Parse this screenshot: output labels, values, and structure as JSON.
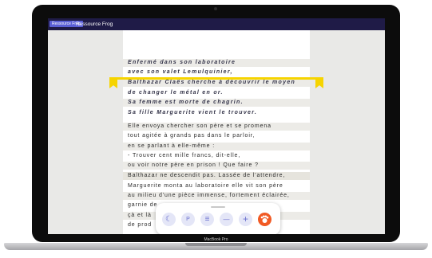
{
  "app": {
    "chip_label": "Ressource Frog",
    "title": "Ressource Frog"
  },
  "device": {
    "brand": "MacBook Pro"
  },
  "document": {
    "lines": [
      {
        "text": "Enfermé dans son laboratoire",
        "style": "italic"
      },
      {
        "text": "avec son valet Lemulquinier,",
        "style": "italic"
      },
      {
        "text": "Balthazar Claës cherche à découvrir le moyen",
        "style": "italic"
      },
      {
        "text": "de changer le métal en or.",
        "style": "italic"
      },
      {
        "text": "Sa femme est morte de chagrin.",
        "style": "italic"
      },
      {
        "text": "Sa fille Marguerite vient le trouver.",
        "style": "italic"
      },
      {
        "text": "Elle envoya chercher son père et se promena",
        "style": "normal"
      },
      {
        "text": "tout agitée à grands pas dans le parloir,",
        "style": "normal"
      },
      {
        "text": "en se parlant à elle-même :",
        "style": "normal"
      },
      {
        "text": "- Trouver cent mille francs, dit-elle,",
        "style": "normal"
      },
      {
        "text": "ou voir notre père en prison ! Que faire ?",
        "style": "normal"
      },
      {
        "text": "Balthazar ne descendit pas. Lassée de l'attendre,",
        "style": "normal"
      },
      {
        "text": "Marguerite monta au laboratoire elle vit son père",
        "style": "normal"
      },
      {
        "text": "au milieu d'une pièce immense, fortement éclairée,",
        "style": "normal"
      },
      {
        "text": "garnie de",
        "style": "normal"
      },
      {
        "text": "çà et là",
        "style": "normal"
      },
      {
        "text": "de prod",
        "style": "normal"
      }
    ]
  },
  "toolbar": {
    "buttons": [
      {
        "name": "night-mode-button",
        "icon": "moon-icon",
        "glyph": "☾"
      },
      {
        "name": "parking-button",
        "icon": "p-icon",
        "glyph": "P"
      },
      {
        "name": "menu-button",
        "icon": "lines-icon",
        "glyph": "≡"
      },
      {
        "name": "zoom-out-button",
        "icon": "minus-icon",
        "glyph": "—"
      },
      {
        "name": "zoom-in-button",
        "icon": "plus-icon",
        "glyph": "+"
      },
      {
        "name": "frog-button",
        "icon": "frog-hand-icon",
        "glyph": ""
      }
    ]
  },
  "colors": {
    "topbar": "#1f1b47",
    "highlight": "#f6d400",
    "accent": "#f15a24",
    "button_bg": "#e4e6f7"
  }
}
